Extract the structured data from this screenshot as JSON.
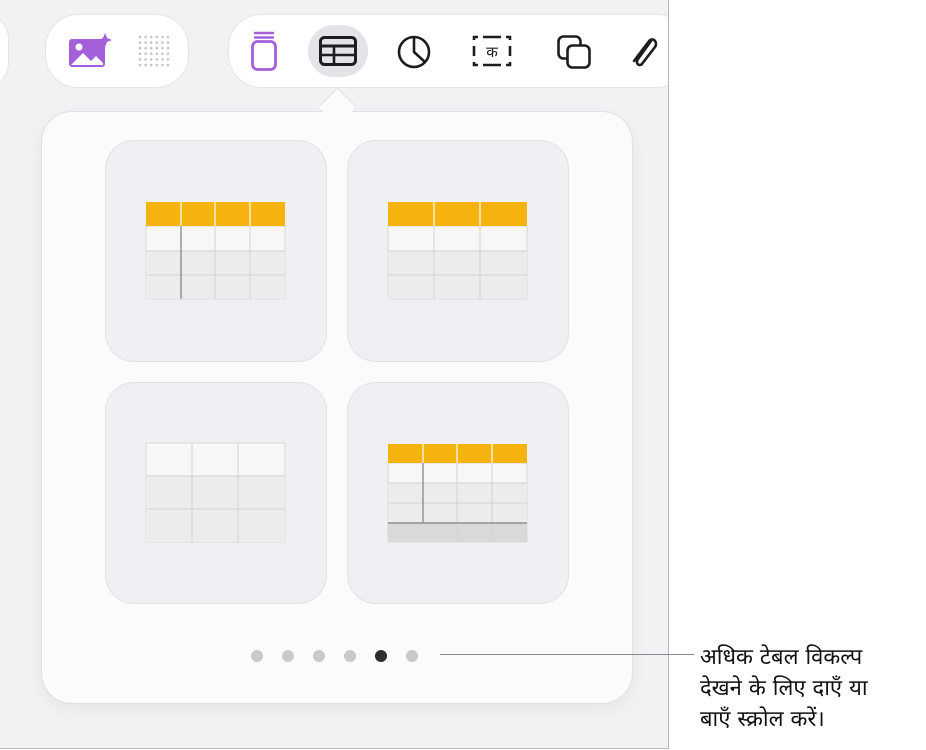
{
  "toolbar": {
    "media_group": [
      {
        "name": "image-playground-icon",
        "color": "#a45fdb"
      },
      {
        "name": "dot-grid-icon"
      }
    ],
    "insert_group": [
      {
        "name": "text-box-icon",
        "color": "#a45fdb"
      },
      {
        "name": "table-icon",
        "active": true
      },
      {
        "name": "chart-icon"
      },
      {
        "name": "text-field-icon",
        "glyph": "क"
      },
      {
        "name": "shape-icon"
      },
      {
        "name": "attachment-icon"
      }
    ]
  },
  "table_styles": [
    {
      "name": "header-row-and-column",
      "header_color": "#f6b310"
    },
    {
      "name": "header-row",
      "header_color": "#f6b310"
    },
    {
      "name": "plain"
    },
    {
      "name": "header-row-column-footer",
      "header_color": "#f6b310"
    }
  ],
  "page_indicator": {
    "count": 6,
    "current": 5
  },
  "callout": {
    "lines": [
      "अधिक टेबल विकल्प",
      "देखने के लिए दाएँ या",
      "बाएँ स्क्रोल करें।"
    ]
  }
}
